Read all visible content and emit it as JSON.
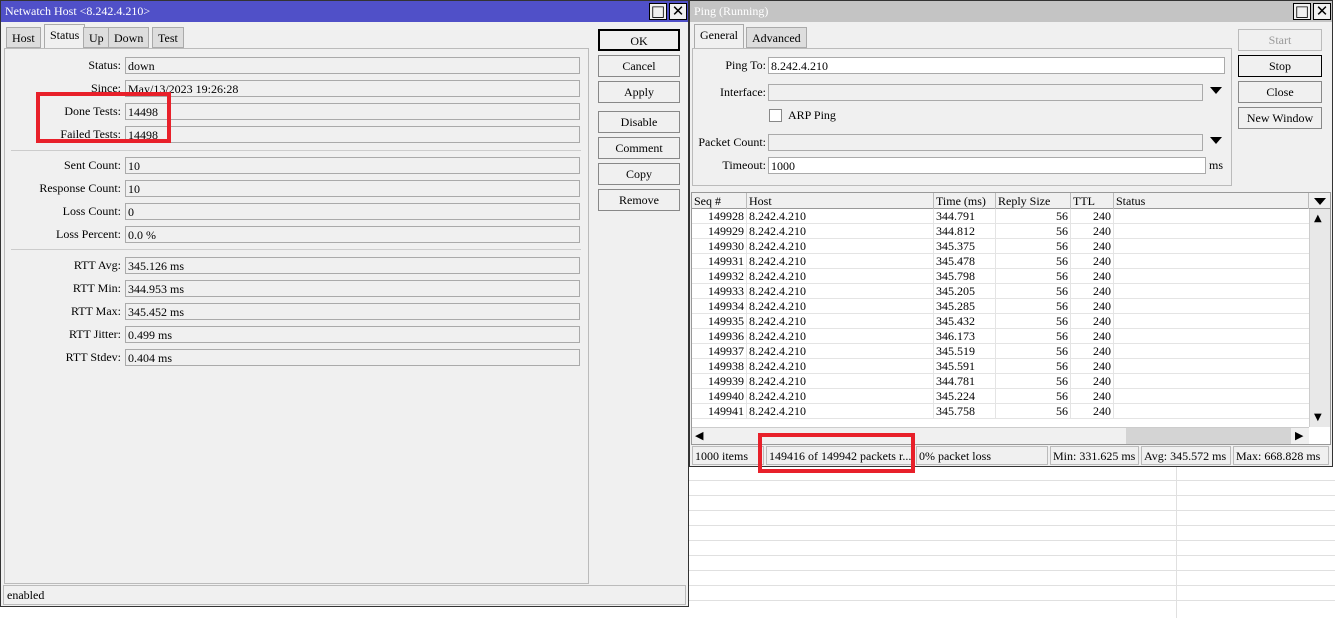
{
  "netwatch": {
    "title": "Netwatch Host <8.242.4.210>",
    "title_color": "#5050c8",
    "tabs": [
      {
        "label": "Host"
      },
      {
        "label": "Status",
        "active": true
      },
      {
        "label": "Up"
      },
      {
        "label": "Down"
      },
      {
        "label": "Test"
      }
    ],
    "fields": [
      {
        "label": "Status:",
        "value": "down"
      },
      {
        "label": "Since:",
        "value": "May/13/2023 19:26:28"
      },
      {
        "label": "Done Tests:",
        "value": "14498"
      },
      {
        "label": "Failed Tests:",
        "value": "14498"
      },
      {
        "label": "Sent Count:",
        "value": "10"
      },
      {
        "label": "Response Count:",
        "value": "10"
      },
      {
        "label": "Loss Count:",
        "value": "0"
      },
      {
        "label": "Loss Percent:",
        "value": "0.0 %"
      },
      {
        "label": "RTT Avg:",
        "value": "345.126 ms"
      },
      {
        "label": "RTT Min:",
        "value": "344.953 ms"
      },
      {
        "label": "RTT Max:",
        "value": "345.452 ms"
      },
      {
        "label": "RTT Jitter:",
        "value": "0.499 ms"
      },
      {
        "label": "RTT Stdev:",
        "value": "0.404 ms"
      }
    ],
    "buttons": [
      "OK",
      "Cancel",
      "Apply",
      "Disable",
      "Comment",
      "Copy",
      "Remove"
    ],
    "status_bar": "enabled"
  },
  "ping": {
    "title": "Ping (Running)",
    "title_color": "#c4c4c4",
    "tabs": [
      {
        "label": "General",
        "active": true
      },
      {
        "label": "Advanced"
      }
    ],
    "ping_to_label": "Ping To:",
    "ping_to": "8.242.4.210",
    "interface_label": "Interface:",
    "interface": "",
    "arp_label": "ARP Ping",
    "arp_checked": false,
    "packet_count_label": "Packet Count:",
    "packet_count": "",
    "timeout_label": "Timeout:",
    "timeout": "1000",
    "timeout_unit": "ms",
    "buttons": {
      "start": "Start",
      "stop": "Stop",
      "close": "Close",
      "new_window": "New Window"
    },
    "columns": [
      "Seq #",
      "Host",
      "Time (ms)",
      "Reply Size",
      "TTL",
      "Status"
    ],
    "rows": [
      [
        "149928",
        "8.242.4.210",
        "344.791",
        "56",
        "240",
        ""
      ],
      [
        "149929",
        "8.242.4.210",
        "344.812",
        "56",
        "240",
        ""
      ],
      [
        "149930",
        "8.242.4.210",
        "345.375",
        "56",
        "240",
        ""
      ],
      [
        "149931",
        "8.242.4.210",
        "345.478",
        "56",
        "240",
        ""
      ],
      [
        "149932",
        "8.242.4.210",
        "345.798",
        "56",
        "240",
        ""
      ],
      [
        "149933",
        "8.242.4.210",
        "345.205",
        "56",
        "240",
        ""
      ],
      [
        "149934",
        "8.242.4.210",
        "345.285",
        "56",
        "240",
        ""
      ],
      [
        "149935",
        "8.242.4.210",
        "345.432",
        "56",
        "240",
        ""
      ],
      [
        "149936",
        "8.242.4.210",
        "346.173",
        "56",
        "240",
        ""
      ],
      [
        "149937",
        "8.242.4.210",
        "345.519",
        "56",
        "240",
        ""
      ],
      [
        "149938",
        "8.242.4.210",
        "345.591",
        "56",
        "240",
        ""
      ],
      [
        "149939",
        "8.242.4.210",
        "344.781",
        "56",
        "240",
        ""
      ],
      [
        "149940",
        "8.242.4.210",
        "345.224",
        "56",
        "240",
        ""
      ],
      [
        "149941",
        "8.242.4.210",
        "345.758",
        "56",
        "240",
        ""
      ]
    ],
    "status": [
      "1000 items",
      "149416 of 149942 packets r...",
      "0% packet loss",
      "Min: 331.625 ms",
      "Avg: 345.572 ms",
      "Max: 668.828 ms"
    ]
  },
  "annotation_color": "#e8202a"
}
